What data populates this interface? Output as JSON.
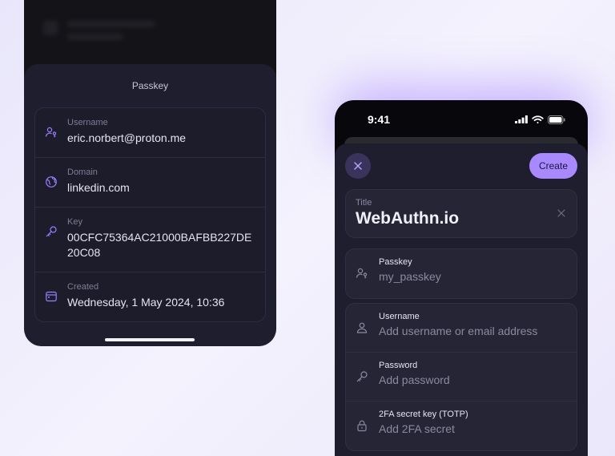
{
  "left_phone": {
    "sheet_title": "Passkey",
    "rows": [
      {
        "icon": "user-key-icon",
        "label": "Username",
        "value": "eric.norbert@proton.me"
      },
      {
        "icon": "globe-icon",
        "label": "Domain",
        "value": "linkedin.com"
      },
      {
        "icon": "key-icon",
        "label": "Key",
        "value": "00CFC75364AC21000BAFBB227DE20C08"
      },
      {
        "icon": "calendar-icon",
        "label": "Created",
        "value": "Wednesday, 1 May 2024, 10:36"
      }
    ]
  },
  "right_phone": {
    "status_time": "9:41",
    "create_label": "Create",
    "title_field": {
      "label": "Title",
      "value": "WebAuthn.io"
    },
    "passkey_field": {
      "label": "Passkey",
      "value": "my_passkey"
    },
    "fields": [
      {
        "icon": "user-icon",
        "label": "Username",
        "placeholder": "Add username or email address"
      },
      {
        "icon": "key-icon",
        "label": "Password",
        "placeholder": "Add password"
      },
      {
        "icon": "lock-icon",
        "label": "2FA secret key (TOTP)",
        "placeholder": "Add 2FA secret"
      }
    ]
  },
  "colors": {
    "accent": "#a889ff",
    "icon_accent": "#9b7dff",
    "sheet_bg": "#1f1e2e",
    "page_bg": "#efedfc"
  }
}
